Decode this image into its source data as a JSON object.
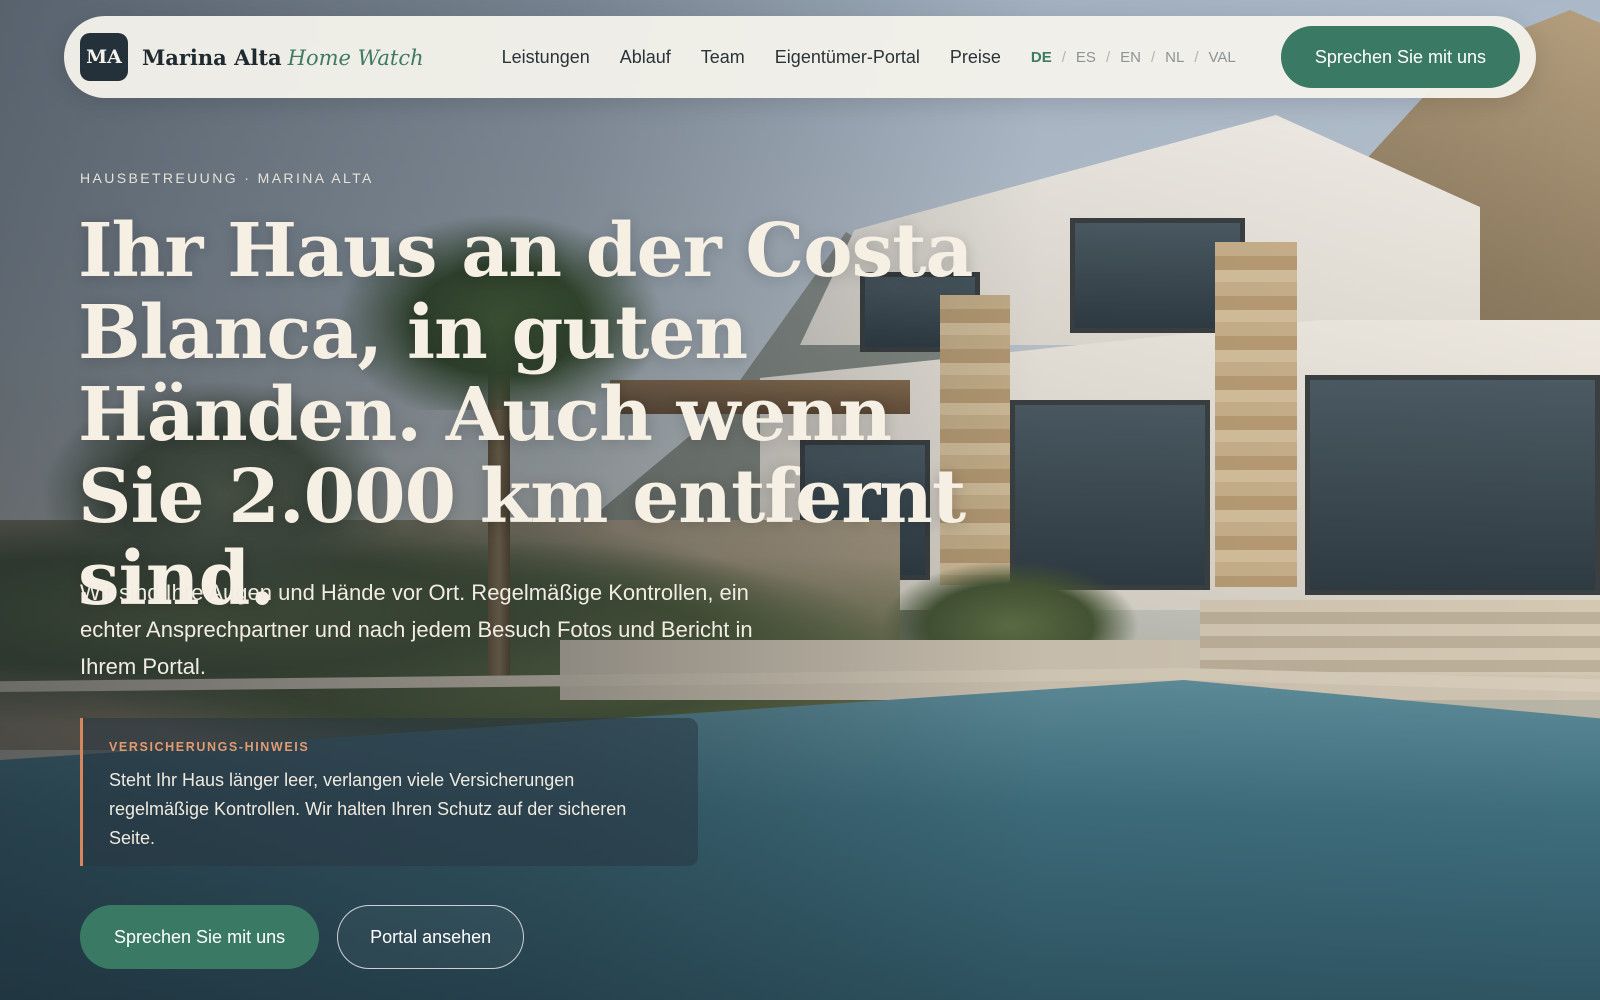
{
  "nav": {
    "logo_initials": "MA",
    "brand_name": "Marina Alta",
    "brand_accent": "Home Watch",
    "menu": [
      "Leistungen",
      "Ablauf",
      "Team",
      "Eigentümer-Portal",
      "Preise"
    ],
    "languages": [
      "DE",
      "ES",
      "EN",
      "NL",
      "VAL"
    ],
    "language_separator": "/",
    "active_language": "DE",
    "cta_label": "Sprechen Sie mit uns"
  },
  "hero": {
    "eyebrow": "HAUSBETREUUNG · MARINA ALTA",
    "headline": "Ihr Haus an der Costa Blanca, in guten Händen. Auch wenn Sie 2.000 km entfernt sind.",
    "subtext": "Wir sind Ihre Augen und Hände vor Ort. Regelmäßige Kontrollen, ein echter Ansprechpartner und nach jedem Besuch Fotos und Bericht in Ihrem Portal.",
    "notice": {
      "label": "VERSICHERUNGS-HINWEIS",
      "text": "Steht Ihr Haus länger leer, verlangen viele Versicherungen regelmäßige Kontrollen. Wir halten Ihren Schutz auf der sicheren Seite."
    },
    "primary_cta": "Sprechen Sie mit uns",
    "secondary_cta": "Portal ansehen"
  },
  "colors": {
    "accent_green": "#3a7a64",
    "logo_dark": "#24313a",
    "notice_border": "#d8875d",
    "nav_background": "#f4f1ea"
  },
  "icons": {
    "hero_image": "villa-with-pool-photo"
  }
}
